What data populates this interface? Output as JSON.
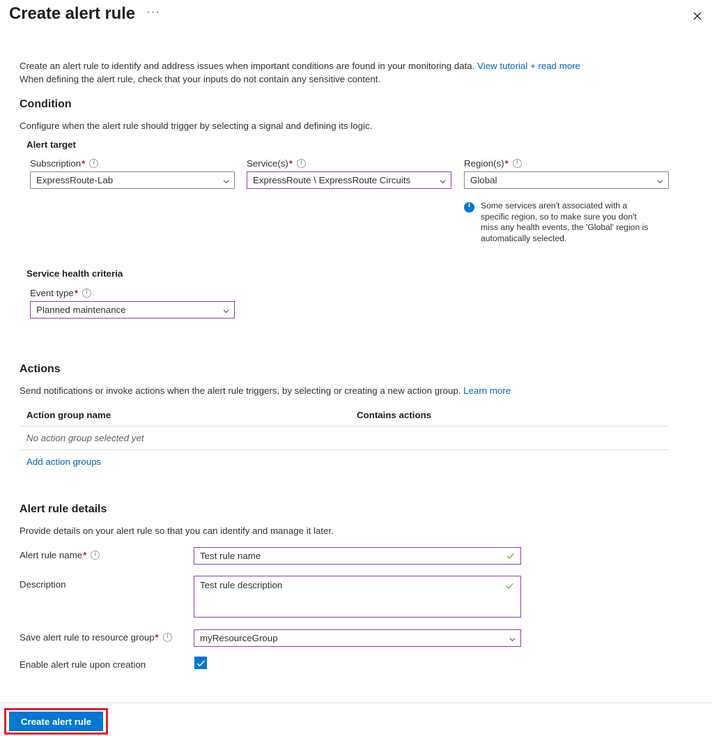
{
  "header": {
    "title": "Create alert rule",
    "more_label": "···",
    "close_label": "✕"
  },
  "intro": {
    "line1": "Create an alert rule to identify and address issues when important conditions are found in your monitoring data.",
    "link": "View tutorial + read more",
    "line2": "When defining the alert rule, check that your inputs do not contain any sensitive content."
  },
  "condition": {
    "heading": "Condition",
    "description": "Configure when the alert rule should trigger by selecting a signal and defining its logic.",
    "alert_target_heading": "Alert target",
    "subscription": {
      "label": "Subscription",
      "required": "*",
      "value": "ExpressRoute-Lab"
    },
    "services": {
      "label": "Service(s)",
      "required": "*",
      "value": "ExpressRoute \\ ExpressRoute Circuits"
    },
    "regions": {
      "label": "Region(s)",
      "required": "*",
      "value": "Global"
    },
    "region_info": "Some services aren't associated with a specific region, so to make sure you don't miss any health events, the 'Global' region is automatically selected.",
    "criteria_heading": "Service health criteria",
    "event_type": {
      "label": "Event type",
      "required": "*",
      "value": "Planned maintenance"
    }
  },
  "actions": {
    "heading": "Actions",
    "description": "Send notifications or invoke actions when the alert rule triggers, by selecting or creating a new action group.",
    "link": "Learn more",
    "columns": [
      "Action group name",
      "Contains actions"
    ],
    "empty_text": "No action group selected yet",
    "add_link": "Add action groups"
  },
  "details": {
    "heading": "Alert rule details",
    "description": "Provide details on your alert rule so that you can identify and manage it later.",
    "rule_name": {
      "label": "Alert rule name",
      "required": "*",
      "value": "Test rule name"
    },
    "description_field": {
      "label": "Description",
      "value": "Test rule description"
    },
    "resource_group": {
      "label": "Save alert rule to resource group",
      "required": "*",
      "value": "myResourceGroup"
    },
    "enable_rule": {
      "label": "Enable alert rule upon creation",
      "checked": true
    }
  },
  "footer": {
    "create_button": "Create alert rule"
  },
  "colors": {
    "accent_blue": "#0078d4",
    "link_blue": "#0067b8",
    "focus_purple": "#8e3eab",
    "required_red": "#a4262c",
    "highlight_red": "#e8192c",
    "valid_green": "#70ad47",
    "border_gray": "#8a8886"
  }
}
